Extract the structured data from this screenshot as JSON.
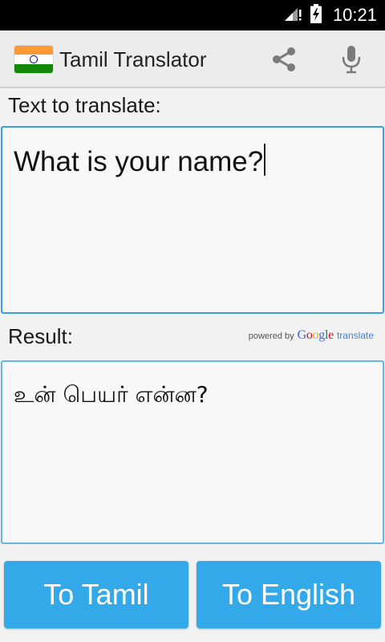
{
  "status_bar": {
    "time": "10:21"
  },
  "action_bar": {
    "title": "Tamil Translator",
    "icons": [
      "india-flag-icon",
      "share-icon",
      "microphone-icon"
    ]
  },
  "input": {
    "label": "Text to translate:",
    "value": "What is your name?"
  },
  "result": {
    "label": "Result:",
    "value": "உன் பெயர் என்ன?",
    "powered_by": {
      "prefix": "powered by",
      "brand": "Google",
      "suffix": "translate"
    }
  },
  "buttons": {
    "to_tamil": "To Tamil",
    "to_english": "To English"
  },
  "colors": {
    "accent": "#33a9ea",
    "box_border": "#3aa0e6",
    "status_bar": "#000000",
    "action_bar": "#ececec"
  }
}
